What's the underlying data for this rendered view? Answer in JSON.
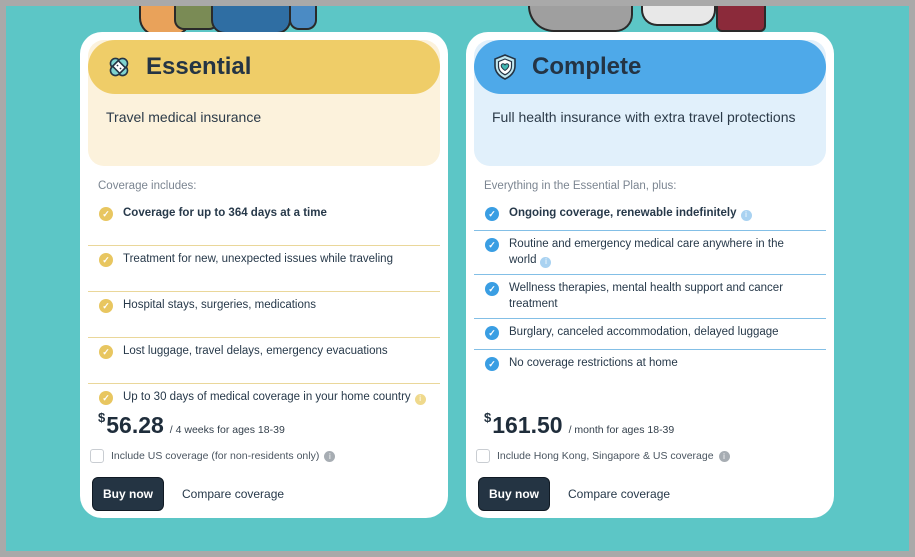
{
  "colors": {
    "background": "#5cc6c6",
    "essential_accent": "#efcd68",
    "essential_tint": "#fcf2dc",
    "complete_accent": "#4ea9e9",
    "complete_tint": "#e1f0fb",
    "button": "#243443"
  },
  "plans": [
    {
      "icon": "bandage-icon",
      "title": "Essential",
      "subtitle": "Travel medical insurance",
      "section_label": "Coverage includes:",
      "features": [
        "Coverage for up to 364 days at a time",
        "Treatment for new, unexpected issues while traveling",
        "Hospital stays, surgeries, medications",
        "Lost luggage, travel delays, emergency evacuations",
        "Up to 30 days of medical coverage in your home country"
      ],
      "price_currency": "$",
      "price_amount": "56.28",
      "price_note": "/ 4 weeks for ages 18-39",
      "option_label": "Include US coverage (for non-residents only)",
      "buy_label": "Buy now",
      "compare_label": "Compare coverage"
    },
    {
      "icon": "shield-heart-icon",
      "title": "Complete",
      "subtitle": "Full health insurance with extra travel protections",
      "section_label": "Everything in the Essential Plan, plus:",
      "features": [
        "Ongoing coverage, renewable indefinitely",
        "Routine and emergency medical care anywhere in the world",
        "Wellness therapies, mental health support and cancer treatment",
        "Burglary, canceled accommodation, delayed luggage",
        "No coverage restrictions at home"
      ],
      "price_currency": "$",
      "price_amount": "161.50",
      "price_note": "/ month for ages 18-39",
      "option_label": "Include Hong Kong, Singapore & US coverage",
      "buy_label": "Buy now",
      "compare_label": "Compare coverage"
    }
  ]
}
